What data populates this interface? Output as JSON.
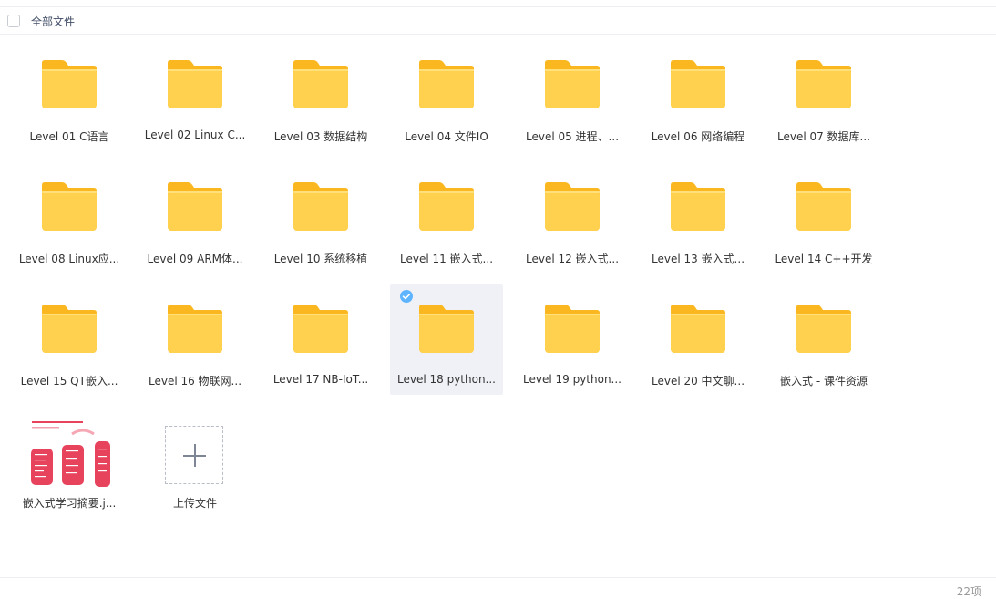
{
  "header": {
    "select_all_label": "全部文件"
  },
  "items": [
    {
      "type": "folder",
      "name": "Level 01 C语言"
    },
    {
      "type": "folder",
      "name": "Level 02 Linux C..."
    },
    {
      "type": "folder",
      "name": "Level 03 数据结构"
    },
    {
      "type": "folder",
      "name": "Level 04 文件IO"
    },
    {
      "type": "folder",
      "name": "Level 05 进程、..."
    },
    {
      "type": "folder",
      "name": "Level 06 网络编程"
    },
    {
      "type": "folder",
      "name": "Level 07 数据库..."
    },
    {
      "type": "folder",
      "name": "Level 08 Linux应..."
    },
    {
      "type": "folder",
      "name": "Level 09 ARM体..."
    },
    {
      "type": "folder",
      "name": "Level 10 系统移植"
    },
    {
      "type": "folder",
      "name": "Level 11 嵌入式..."
    },
    {
      "type": "folder",
      "name": "Level 12 嵌入式..."
    },
    {
      "type": "folder",
      "name": "Level 13 嵌入式..."
    },
    {
      "type": "folder",
      "name": "Level 14 C++开发"
    },
    {
      "type": "folder",
      "name": "Level 15 QT嵌入..."
    },
    {
      "type": "folder",
      "name": "Level 16 物联网..."
    },
    {
      "type": "folder",
      "name": "Level 17 NB-IoT..."
    },
    {
      "type": "folder",
      "name": "Level 18 python...",
      "selected": true
    },
    {
      "type": "folder",
      "name": "Level 19 python..."
    },
    {
      "type": "folder",
      "name": "Level 20 中文聊..."
    },
    {
      "type": "folder",
      "name": "嵌入式 - 课件资源"
    },
    {
      "type": "image",
      "name": "嵌入式学习摘要.j..."
    },
    {
      "type": "upload",
      "name": "上传文件"
    }
  ],
  "footer": {
    "count_label": "22项"
  },
  "colors": {
    "folder_front": "#ffd14f",
    "folder_back": "#fbb720",
    "selected_bg": "#f0f1f6",
    "check_blue": "#5eb4ff"
  },
  "icons": {
    "folder": "folder-icon",
    "upload": "plus-icon",
    "check": "check-circle-icon"
  }
}
